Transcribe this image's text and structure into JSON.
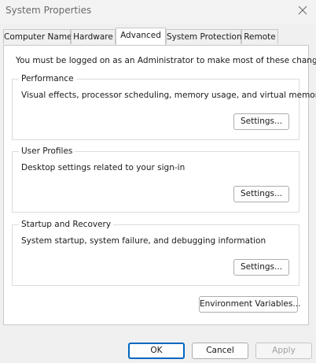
{
  "window": {
    "title": "System Properties"
  },
  "tabs": [
    {
      "label": "Computer Name"
    },
    {
      "label": "Hardware"
    },
    {
      "label": "Advanced"
    },
    {
      "label": "System Protection"
    },
    {
      "label": "Remote"
    }
  ],
  "advanced": {
    "admin_note": "You must be logged on as an Administrator to make most of these changes.",
    "performance": {
      "label": "Performance",
      "description": "Visual effects, processor scheduling, memory usage, and virtual memory",
      "button": "Settings..."
    },
    "user_profiles": {
      "label": "User Profiles",
      "description": "Desktop settings related to your sign-in",
      "button": "Settings..."
    },
    "startup_recovery": {
      "label": "Startup and Recovery",
      "description": "System startup, system failure, and debugging information",
      "button": "Settings..."
    },
    "env_button": "Environment Variables..."
  },
  "footer": {
    "ok": "OK",
    "cancel": "Cancel",
    "apply": "Apply"
  },
  "colors": {
    "accent": "#0067c0",
    "window_bg": "#f0f0f0",
    "panel_bg": "#ffffff"
  },
  "icons": {
    "close": "close-icon"
  }
}
